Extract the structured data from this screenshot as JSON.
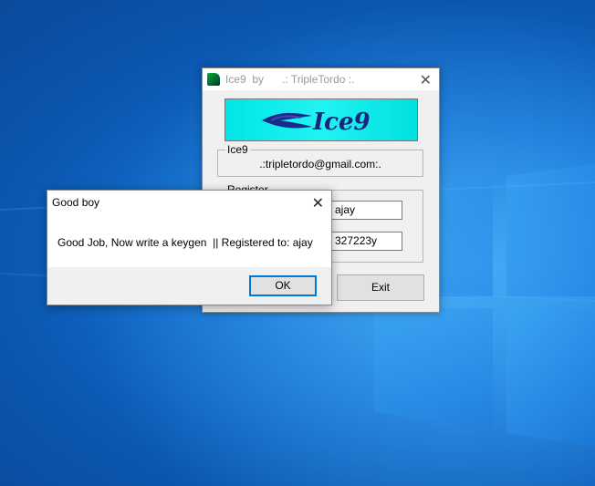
{
  "desktop": {
    "accent": "#1677d6"
  },
  "main_window": {
    "title": "Ice9  by      .: TripleTordo :.",
    "banner_text": "Ice9",
    "info_group": {
      "title": "Ice9",
      "email": ".:tripletordo@gmail.com:."
    },
    "register_group": {
      "title": "Register",
      "name_value": "ajay",
      "serial_value": "327223y"
    },
    "exit_label": "Exit"
  },
  "message_box": {
    "title": "Good boy",
    "text": "Good Job, Now write a keygen  || Registered to: ajay",
    "ok_label": "OK"
  },
  "icons": {
    "app": "ice9-app-icon",
    "close": "close-icon"
  }
}
